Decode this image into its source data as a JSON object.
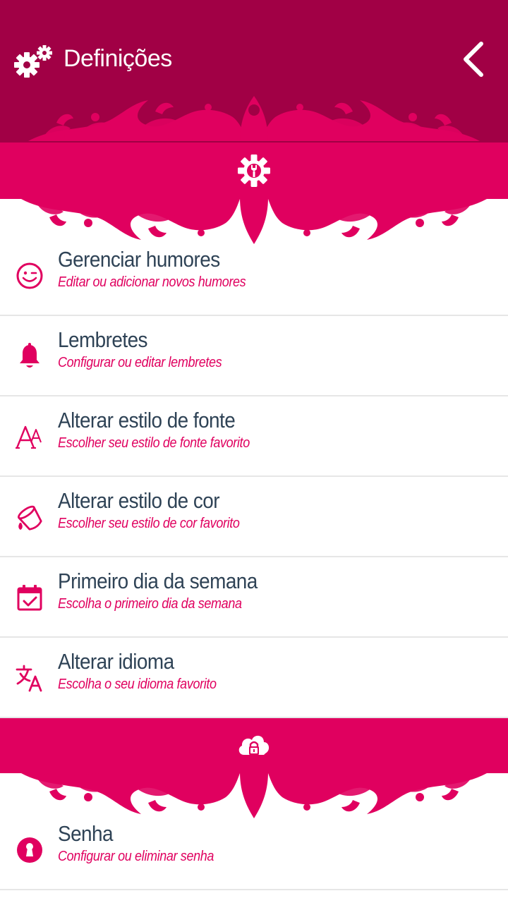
{
  "header": {
    "title": "Definições",
    "settings_icon": "gears-icon",
    "back_icon": "chevron-left-icon"
  },
  "colors": {
    "header_bg": "#a10045",
    "accent": "#e0005f",
    "label_text": "#2f4356",
    "divider": "#e6e6e6"
  },
  "sections": [
    {
      "icon": "wrench-gear-icon",
      "items": [
        {
          "icon": "smiley-icon",
          "title": "Gerenciar humores",
          "subtitle": "Editar ou adicionar novos humores"
        },
        {
          "icon": "bell-icon",
          "title": "Lembretes",
          "subtitle": "Configurar ou editar lembretes"
        },
        {
          "icon": "font-style-icon",
          "title": "Alterar estilo de fonte",
          "subtitle": "Escolher seu estilo de fonte favorito"
        },
        {
          "icon": "paint-bucket-icon",
          "title": "Alterar estilo de cor",
          "subtitle": "Escolher seu estilo de cor favorito"
        },
        {
          "icon": "calendar-check-icon",
          "title": "Primeiro dia da semana",
          "subtitle": "Escolha o primeiro dia da semana"
        },
        {
          "icon": "translate-icon",
          "title": "Alterar idioma",
          "subtitle": "Escolha o seu idioma favorito"
        }
      ]
    },
    {
      "icon": "cloud-lock-icon",
      "items": [
        {
          "icon": "keyhole-icon",
          "title": "Senha",
          "subtitle": "Configurar ou eliminar senha"
        }
      ]
    }
  ]
}
